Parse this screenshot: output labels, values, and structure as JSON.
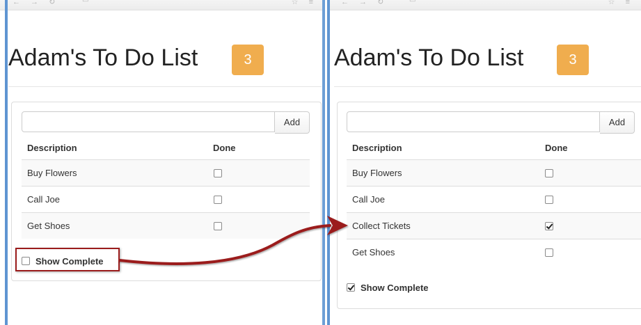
{
  "colors": {
    "badge": "#f0ad4e",
    "highlight": "#9b1c1c",
    "window_edge": "#5f95d2"
  },
  "left": {
    "title": "Adam's To Do List",
    "badge": "3",
    "add_label": "Add",
    "columns": [
      "Description",
      "Done"
    ],
    "items": [
      {
        "description": "Buy Flowers",
        "done": false
      },
      {
        "description": "Call Joe",
        "done": false
      },
      {
        "description": "Get Shoes",
        "done": false
      }
    ],
    "show_complete_label": "Show Complete",
    "show_complete_checked": false
  },
  "right": {
    "title": "Adam's To Do List",
    "badge": "3",
    "add_label": "Add",
    "columns": [
      "Description",
      "Done"
    ],
    "items": [
      {
        "description": "Buy Flowers",
        "done": false
      },
      {
        "description": "Call Joe",
        "done": false
      },
      {
        "description": "Collect Tickets",
        "done": true
      },
      {
        "description": "Get Shoes",
        "done": false
      }
    ],
    "show_complete_label": "Show Complete",
    "show_complete_checked": true
  }
}
